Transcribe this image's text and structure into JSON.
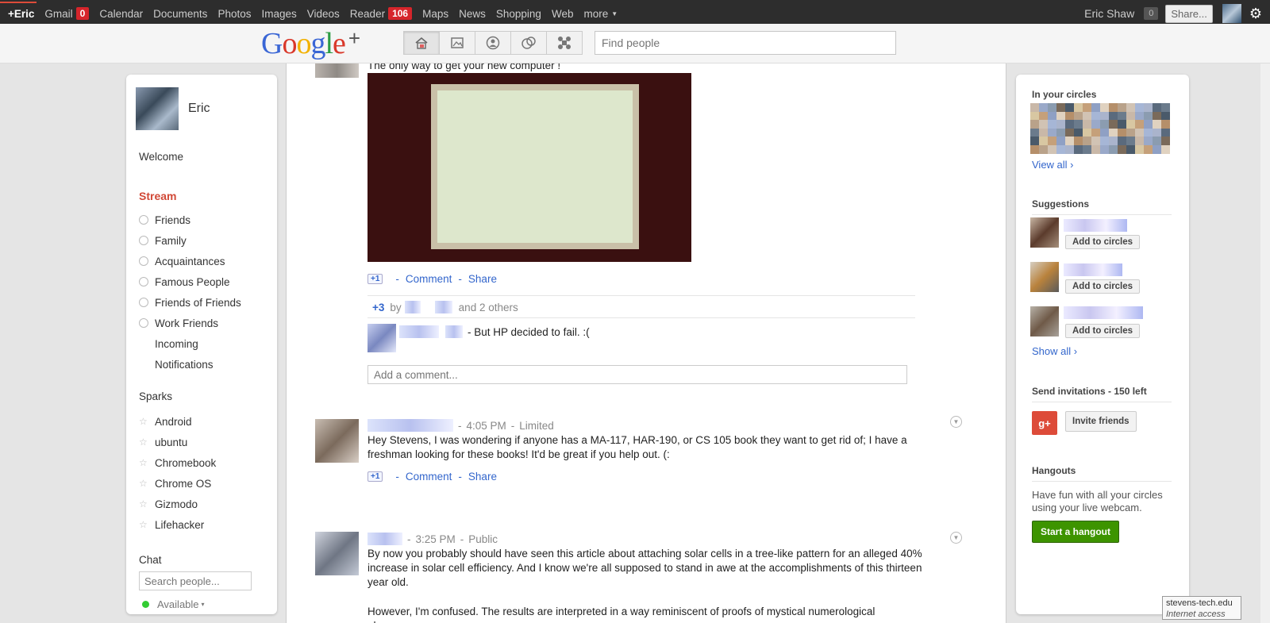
{
  "topbar": {
    "items": [
      {
        "label": "+Eric",
        "active": true
      },
      {
        "label": "Gmail",
        "badge": "0"
      },
      {
        "label": "Calendar"
      },
      {
        "label": "Documents"
      },
      {
        "label": "Photos"
      },
      {
        "label": "Images"
      },
      {
        "label": "Videos"
      },
      {
        "label": "Reader",
        "badge": "106"
      },
      {
        "label": "Maps"
      },
      {
        "label": "News"
      },
      {
        "label": "Shopping"
      },
      {
        "label": "Web"
      },
      {
        "label": "more"
      }
    ],
    "user_name": "Eric Shaw",
    "notification_count": "0",
    "share_label": "Share...",
    "icons": [
      "gear-icon",
      "caret-down-icon"
    ]
  },
  "header": {
    "logo_text": "Google+",
    "mode_icons": [
      "home-icon",
      "photos-icon",
      "profile-icon",
      "circles-icon",
      "games-icon"
    ],
    "find_people_placeholder": "Find people"
  },
  "left": {
    "profile_name": "Eric",
    "welcome": "Welcome",
    "stream_label": "Stream",
    "circles": [
      "Friends",
      "Family",
      "Acquaintances",
      "Famous People",
      "Friends of Friends",
      "Work Friends"
    ],
    "extra_links": [
      "Incoming",
      "Notifications"
    ],
    "sparks_heading": "Sparks",
    "sparks": [
      "Android",
      "ubuntu",
      "Chromebook",
      "Chrome OS",
      "Gizmodo",
      "Lifehacker"
    ],
    "chat_heading": "Chat",
    "chat_search_placeholder": "Search people...",
    "available_label": "Available"
  },
  "stream": {
    "post1": {
      "caption": "The only way to get your new computer !",
      "plusone": "+1",
      "comment_label": "Comment",
      "share_label": "Share",
      "plus_count": "+3",
      "by_label": "by",
      "others_label": "and 2 others",
      "comment_text": "- But HP decided to fail. :(",
      "add_comment_placeholder": "Add a comment..."
    },
    "post2": {
      "time": "4:05 PM",
      "visibility": "Limited",
      "text": "Hey Stevens, I was wondering if anyone has a MA-117, HAR-190, or CS 105 book they want to get rid of; I have a freshman looking for these books! It'd be great if you help out. (:",
      "plusone": "+1",
      "comment_label": "Comment",
      "share_label": "Share"
    },
    "post3": {
      "time": "3:25 PM",
      "visibility": "Public",
      "text": "By now you probably should have seen this article about attaching solar cells in a tree-like pattern for an alleged 40% increase in solar cell efficiency. And I know we're all supposed to stand in awe at the accomplishments of this thirteen year old.",
      "text2": "However, I'm confused. The results are interpreted in a way reminiscent of proofs of mystical numerological phenomena"
    }
  },
  "right": {
    "circles_heading": "In your circles",
    "view_all": "View all ›",
    "suggestions_heading": "Suggestions",
    "add_to_circles": "Add to circles",
    "show_all": "Show all ›",
    "invites_heading": "Send invitations - 150 left",
    "invite_button": "Invite friends",
    "invite_icon_text": "g+",
    "hangouts_heading": "Hangouts",
    "hangouts_text": "Have fun with all your circles using your live webcam.",
    "hangout_button": "Start a hangout"
  },
  "statusbar": {
    "host": "stevens-tech.edu",
    "zone": "Internet access"
  },
  "colors": {
    "topbar_bg": "#2d2d2d",
    "stream_red": "#d14836",
    "link_blue": "#3366cc",
    "badge_red": "#d6252b",
    "hangout_green": "#3d9400"
  }
}
